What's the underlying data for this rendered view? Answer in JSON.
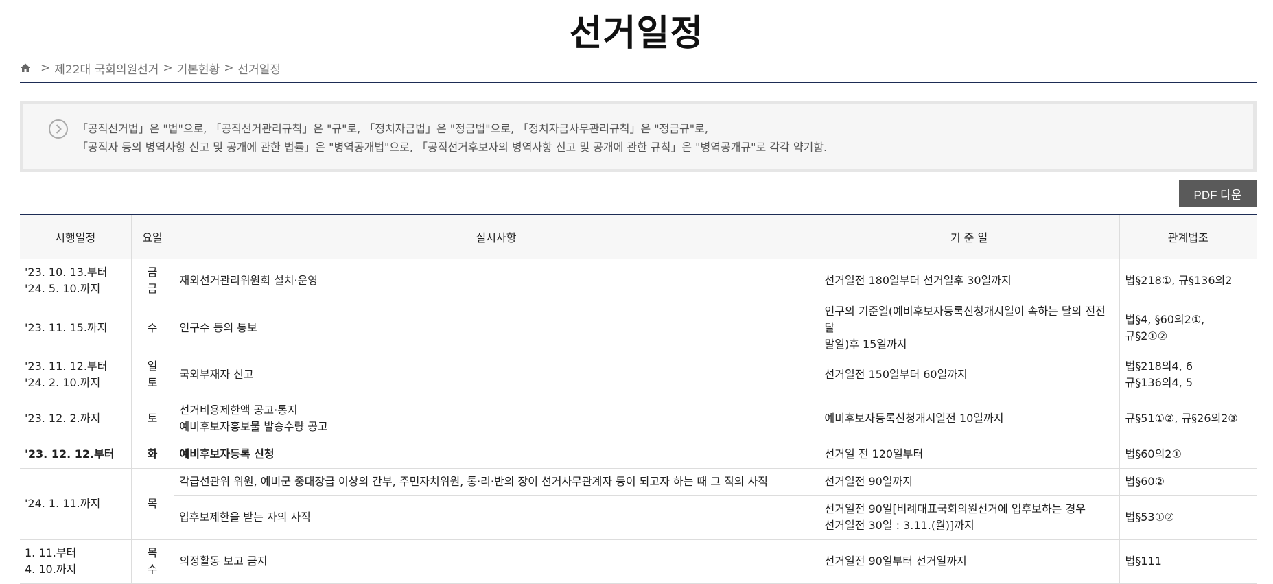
{
  "page": {
    "title": "선거일정"
  },
  "breadcrumb": {
    "items": [
      "제22대 국회의원선거",
      "기본현황",
      "선거일정"
    ],
    "separator": ">"
  },
  "notice": {
    "line1": "「공직선거법」은 \"법\"으로, 「공직선거관리규칙」은 \"규\"로, 「정치자금법」은 \"정금법\"으로, 「정치자금사무관리규칙」은 \"정금규\"로,",
    "line2": "「공직자 등의 병역사항 신고 및 공개에 관한 법률」은 \"병역공개법\"으로, 「공직선거후보자의 병역사항 신고 및 공개에 관한 규칙」은 \"병역공개규\"로 각각 약기함."
  },
  "toolbar": {
    "pdf_label": "PDF 다운"
  },
  "table": {
    "headers": {
      "date": "시행일정",
      "day": "요일",
      "item": "실시사항",
      "basis": "기 준 일",
      "law": "관계법조"
    },
    "rows": [
      {
        "date": [
          "'23. 10. 13.부터",
          "'24. 5. 10.까지"
        ],
        "day": [
          "금",
          "금"
        ],
        "item": [
          "재외선거관리위원회 설치·운영"
        ],
        "basis": [
          "선거일전 180일부터 선거일후 30일까지"
        ],
        "law": [
          "법§218①, 규§136의2"
        ]
      },
      {
        "date": [
          "'23. 11. 15.까지"
        ],
        "day": [
          "수"
        ],
        "item": [
          "인구수 등의 통보"
        ],
        "basis": [
          "인구의 기준일(예비후보자등록신청개시일이 속하는 달의 전전달",
          "말일)후 15일까지"
        ],
        "law": [
          "법§4, §60의2①,",
          "규§2①②"
        ]
      },
      {
        "date": [
          "'23. 11. 12.부터",
          "'24. 2. 10.까지"
        ],
        "day": [
          "일",
          "토"
        ],
        "item": [
          "국외부재자 신고"
        ],
        "basis": [
          "선거일전 150일부터 60일까지"
        ],
        "law": [
          "법§218의4, 6",
          "규§136의4, 5"
        ]
      },
      {
        "date": [
          "'23. 12. 2.까지"
        ],
        "day": [
          "토"
        ],
        "item": [
          "선거비용제한액 공고·통지",
          "예비후보자홍보물 발송수량 공고"
        ],
        "basis": [
          "예비후보자등록신청개시일전 10일까지"
        ],
        "law": [
          "규§51①②, 규§26의2③"
        ]
      },
      {
        "date": [
          "'23. 12. 12.부터"
        ],
        "day": [
          "화"
        ],
        "item": [
          "예비후보자등록 신청"
        ],
        "basis": [
          "선거일 전 120일부터"
        ],
        "law": [
          "법§60의2①"
        ]
      },
      {
        "date": [
          "'24. 1. 11.까지"
        ],
        "day": [
          "목"
        ],
        "item": [
          "각급선관위 위원, 예비군 중대장급 이상의 간부, 주민자치위원, 통·리·반의 장이 선거사무관계자 등이 되고자 하는 때 그 직의 사직"
        ],
        "basis": [
          "선거일전 90일까지"
        ],
        "law": [
          "법§60②"
        ]
      },
      {
        "item": [
          "입후보제한을 받는 자의 사직"
        ],
        "basis": [
          "선거일전 90일[비례대표국회의원선거에 입후보하는 경우",
          "선거일전 30일 : 3.11.(월)]까지"
        ],
        "law": [
          "법§53①②"
        ]
      },
      {
        "date": [
          "1. 11.부터",
          "4. 10.까지"
        ],
        "day": [
          "목",
          "수"
        ],
        "item": [
          "의정활동 보고 금지"
        ],
        "basis": [
          "선거일전 90일부터 선거일까지"
        ],
        "law": [
          "법§111"
        ]
      }
    ]
  },
  "icons": {
    "home": "home-icon",
    "notice": "chevron-circle-right-icon"
  },
  "colors": {
    "accent": "#1d2c55",
    "button": "#5a5a5a",
    "header_bg": "#f7f7f7",
    "notice_bg": "#f6f6f6"
  }
}
